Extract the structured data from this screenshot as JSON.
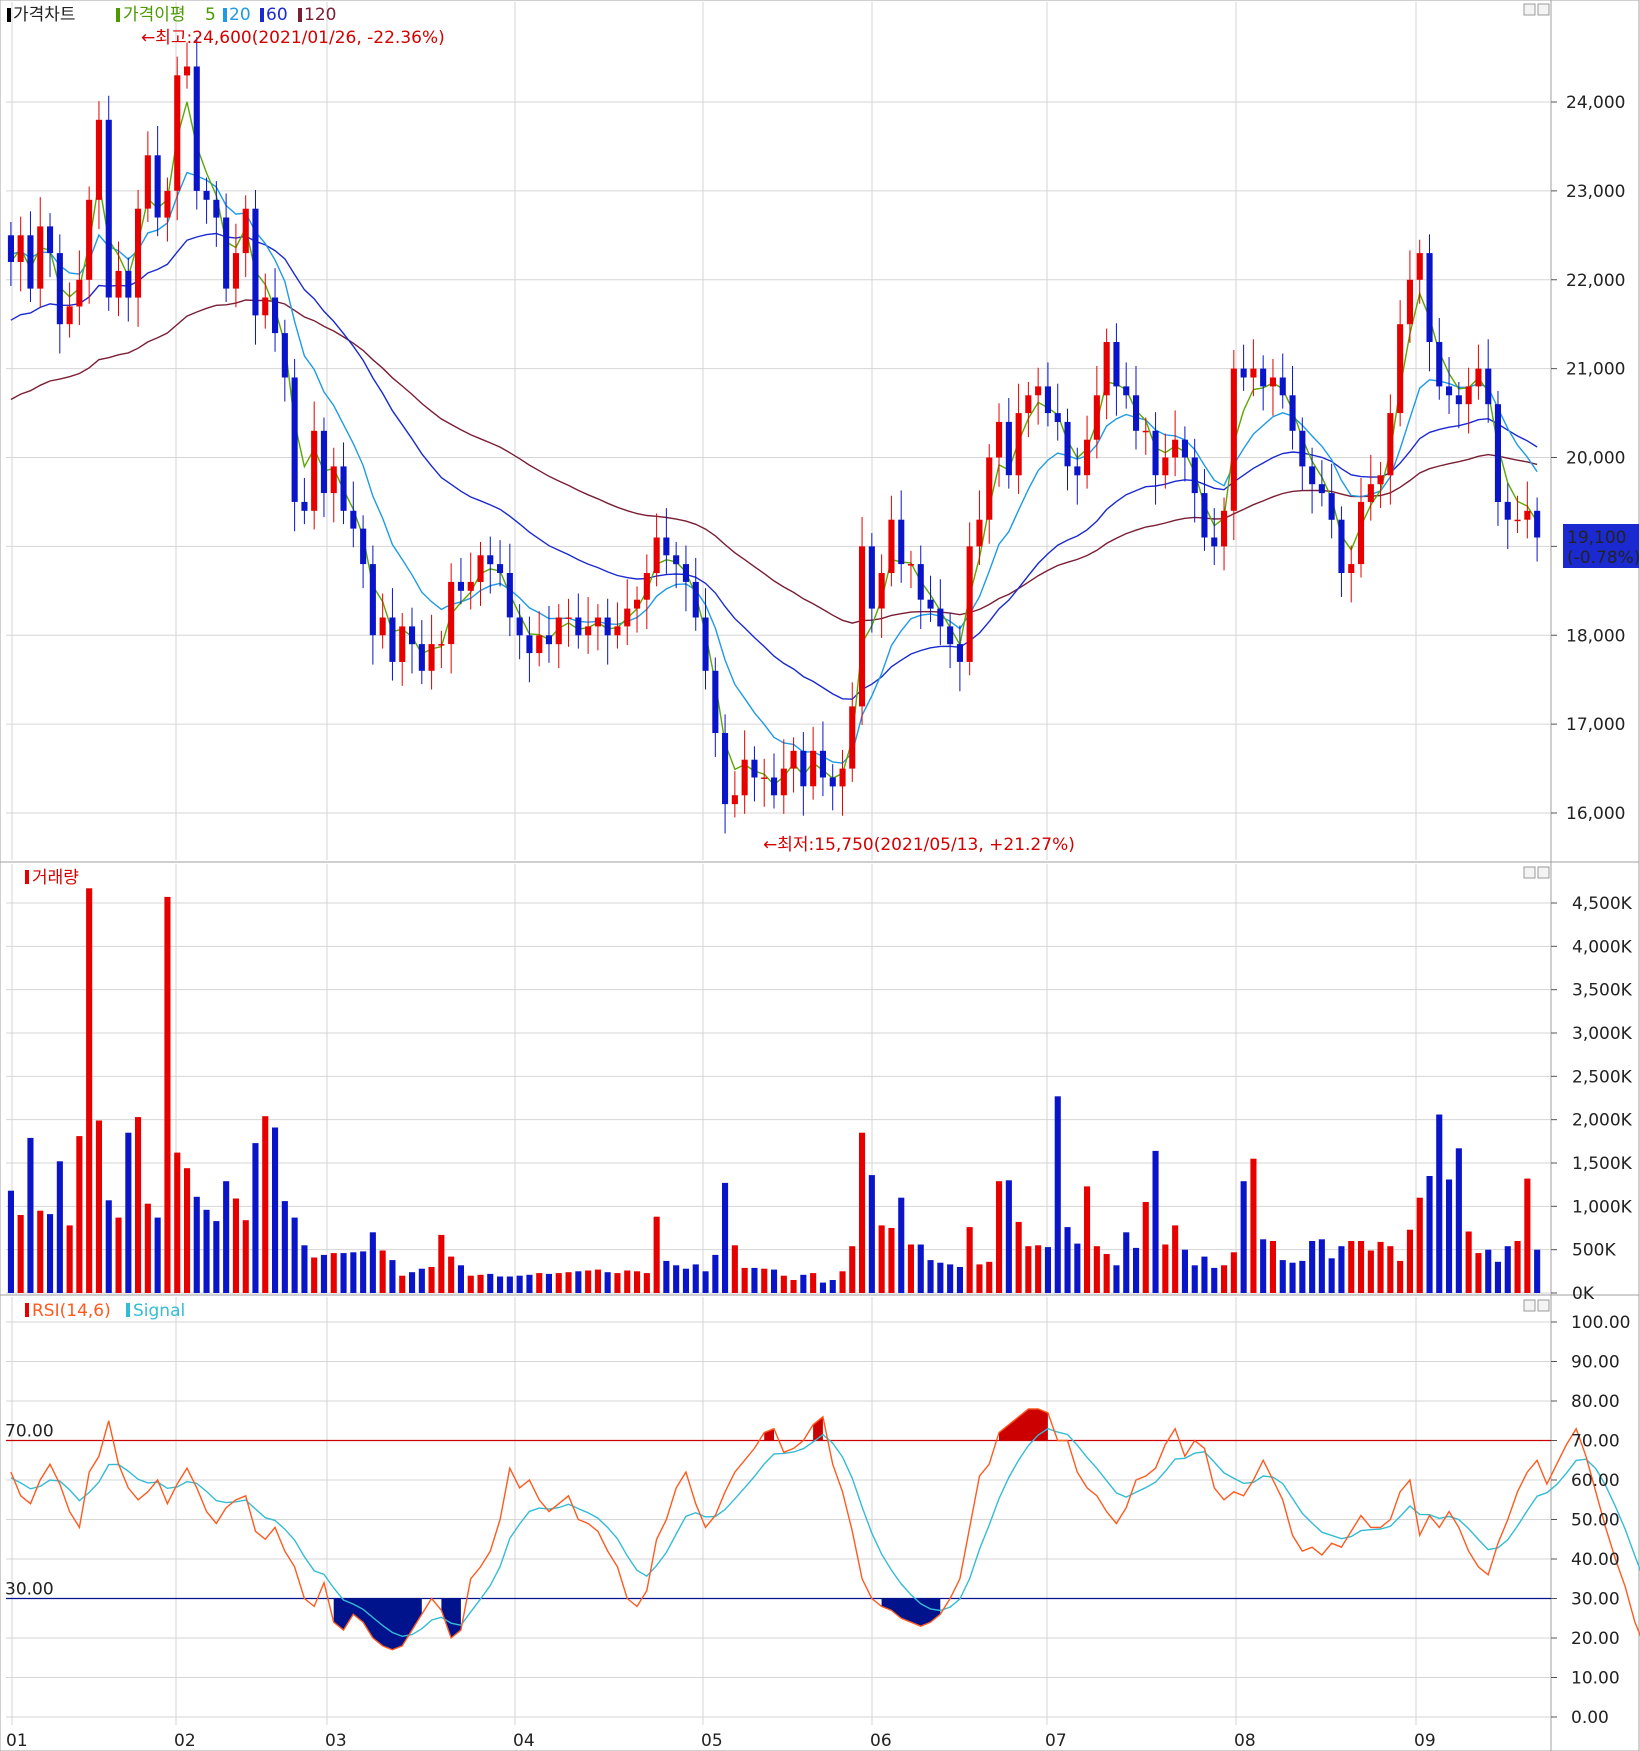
{
  "colors": {
    "up": "#e60000",
    "down": "#0a14c8",
    "ma5": "#5aa800",
    "ma20": "#1e9be6",
    "ma60": "#1a2ad0",
    "ma120": "#7a1e34",
    "rsi": "#ff5a1e",
    "signal": "#34bcd6",
    "overbought_fill": "#cc0000",
    "oversold_fill": "#00128c",
    "grid": "#d6d6d6",
    "last_price_bg": "#1a2ad0"
  },
  "panels": {
    "price": {
      "legend": [
        {
          "text": "가격차트",
          "color": "#222222",
          "marker": "#000000"
        },
        {
          "text": "가격이평",
          "color": "#4a9a00",
          "marker": "#4a9a00"
        },
        {
          "text": "5",
          "color": "#4a9a00"
        },
        {
          "text": "20",
          "color": "#1e9be6",
          "marker": "#1e9be6"
        },
        {
          "text": "60",
          "color": "#1a2ad0",
          "marker": "#1a2ad0"
        },
        {
          "text": "120",
          "color": "#7a1e34",
          "marker": "#7a1e34"
        }
      ],
      "yticks": [
        "24,000",
        "23,000",
        "22,000",
        "21,000",
        "20,000",
        "19,000",
        "18,000",
        "17,000",
        "16,000"
      ],
      "high_annotation": "←최고:24,600(2021/01/26, -22.36%)",
      "low_annotation": "←최저:15,750(2021/05/13, +21.27%)",
      "last_price": "19,100",
      "last_change": "(-0.78%)"
    },
    "volume": {
      "legend": "거래량",
      "yticks": [
        "4,500K",
        "4,000K",
        "3,500K",
        "3,000K",
        "2,500K",
        "2,000K",
        "1,500K",
        "1,000K",
        "500K",
        "0K"
      ]
    },
    "rsi": {
      "legend_rsi": "RSI(14,6)",
      "legend_signal": "Signal",
      "yticks": [
        "100.00",
        "90.00",
        "80.00",
        "70.00",
        "60.00",
        "50.00",
        "40.00",
        "30.00",
        "20.00",
        "10.00",
        "0.00"
      ],
      "upper_label": "70.00",
      "lower_label": "30.00"
    }
  },
  "x_labels": [
    "01",
    "02",
    "03",
    "04",
    "05",
    "06",
    "07",
    "08",
    "09"
  ],
  "chart_data": [
    {
      "type": "candlestick",
      "title": "가격차트",
      "period": "2021/01 - 2021/09",
      "ylim": [
        15600,
        24900
      ],
      "key_points": {
        "high": 24600,
        "high_date": "2021/01/26",
        "low": 15750,
        "low_date": "2021/05/13",
        "last": 19100,
        "last_change_pct": -0.78
      },
      "close_estimates": [
        22200,
        22500,
        21900,
        22600,
        22300,
        21500,
        21700,
        22000,
        22900,
        23800,
        21800,
        22100,
        21800,
        22800,
        23400,
        22700,
        23000,
        24300,
        24400,
        23000,
        22900,
        22700,
        21900,
        22300,
        22800,
        21600,
        21800,
        21400,
        20900,
        19500,
        19400,
        20300,
        19600,
        19900,
        19400,
        19200,
        18800,
        18000,
        18200,
        17700,
        18100,
        17900,
        17600,
        17900,
        17900,
        18600,
        18500,
        18600,
        18900,
        18800,
        18700,
        18200,
        18000,
        17800,
        18000,
        17900,
        18200,
        18200,
        18000,
        18100,
        18200,
        18000,
        18100,
        18300,
        18400,
        18700,
        19100,
        18900,
        18800,
        18600,
        18200,
        17600,
        16900,
        16100,
        16200,
        16600,
        16400,
        16400,
        16200,
        16500,
        16700,
        16300,
        16700,
        16400,
        16300,
        16500,
        17200,
        19000,
        18300,
        18700,
        19300,
        18800,
        18800,
        18400,
        18300,
        18100,
        17900,
        17700,
        19000,
        19300,
        20000,
        20400,
        19800,
        20500,
        20700,
        20800,
        20500,
        20400,
        19900,
        19800,
        20200,
        20700,
        21300,
        20800,
        20700,
        20300,
        20300,
        19800,
        20000,
        20200,
        20000,
        19600,
        19100,
        19000,
        19400,
        21000,
        20900,
        21000,
        20800,
        20900,
        20700,
        20300,
        19900,
        19700,
        19600,
        19300,
        18700,
        18800,
        19500,
        19700,
        19800,
        20500,
        21500,
        22000,
        22300,
        21300,
        20800,
        20700,
        20600,
        20800,
        21000,
        20600,
        19500,
        19300,
        19300,
        19400,
        19100
      ],
      "volume_k_estimates": [
        1180,
        900,
        1790,
        950,
        910,
        1520,
        780,
        1810,
        4670,
        1990,
        1070,
        870,
        1850,
        2030,
        1030,
        870,
        4570,
        1620,
        1440,
        1110,
        960,
        830,
        1290,
        1090,
        840,
        1730,
        2040,
        1910,
        1060,
        870,
        550,
        410,
        440,
        460,
        460,
        470,
        480,
        700,
        490,
        380,
        200,
        240,
        280,
        300,
        670,
        420,
        320,
        200,
        210,
        220,
        190,
        190,
        200,
        210,
        230,
        220,
        230,
        240,
        250,
        260,
        270,
        240,
        230,
        260,
        250,
        230,
        880,
        370,
        320,
        280,
        330,
        250,
        440,
        1270,
        550,
        290,
        290,
        280,
        270,
        200,
        150,
        210,
        230,
        120,
        150,
        250,
        540,
        1850,
        1360,
        780,
        750,
        1100,
        560,
        560,
        380,
        350,
        330,
        300,
        760,
        330,
        360,
        1290,
        1300,
        820,
        540,
        550,
        530,
        2270,
        760,
        570,
        1230,
        540,
        450,
        320,
        700,
        520,
        1050,
        1640,
        560,
        780,
        500,
        320,
        420,
        290,
        320,
        470,
        1290,
        1550,
        620,
        600,
        380,
        350,
        370,
        600,
        620,
        400,
        540,
        600,
        600,
        490,
        590,
        540,
        370,
        730,
        1100,
        1350,
        2060,
        1310,
        1670,
        710,
        460,
        500,
        360,
        540,
        600,
        1320,
        500,
        480,
        310,
        290,
        270
      ],
      "rsi_estimates": [
        62,
        56,
        54,
        60,
        64,
        59,
        52,
        48,
        62,
        66,
        75,
        64,
        58,
        55,
        57,
        60,
        54,
        59,
        63,
        58,
        52,
        49,
        53,
        55,
        56,
        47,
        45,
        48,
        42,
        38,
        30,
        28,
        34,
        24,
        22,
        26,
        24,
        20,
        18,
        17,
        18,
        22,
        26,
        30,
        27,
        20,
        22,
        35,
        38,
        42,
        50,
        63,
        58,
        60,
        55,
        52,
        54,
        56,
        50,
        49,
        47,
        42,
        38,
        30,
        28,
        32,
        45,
        50,
        58,
        62,
        54,
        48,
        51,
        57,
        62,
        65,
        68,
        72,
        73,
        67,
        68,
        70,
        74,
        76,
        64,
        57,
        47,
        35,
        30,
        28,
        27,
        25,
        24,
        23,
        24,
        26,
        30,
        35,
        48,
        61,
        64,
        72,
        74,
        76,
        78,
        78,
        77,
        70,
        70,
        62,
        58,
        56,
        52,
        49,
        53,
        60,
        61,
        63,
        69,
        73,
        66,
        70,
        68,
        58,
        55,
        57,
        56,
        60,
        65,
        60,
        55,
        46,
        42,
        43,
        41,
        44,
        43,
        47,
        51,
        48,
        48,
        50,
        57,
        60,
        46,
        51,
        48,
        52,
        48,
        42,
        38,
        36,
        44,
        50,
        57,
        62,
        65,
        59,
        64,
        69,
        73,
        66,
        57,
        48,
        40,
        33,
        24,
        18
      ]
    }
  ]
}
